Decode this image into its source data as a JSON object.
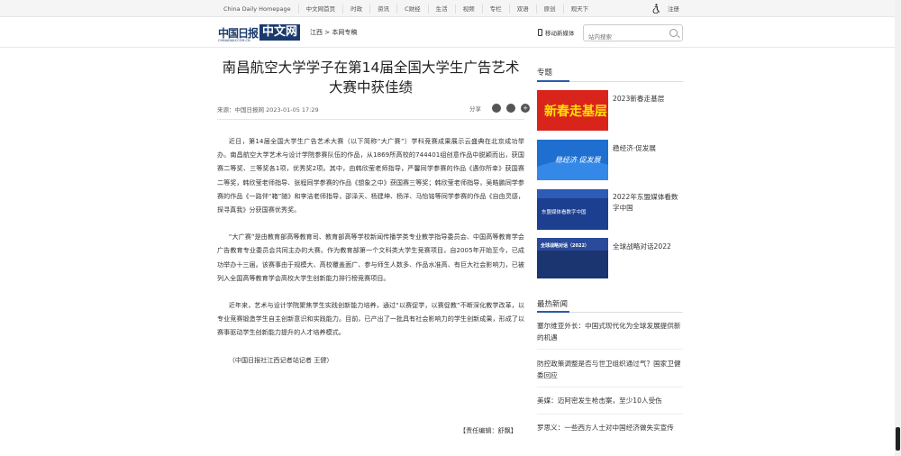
{
  "topnav": [
    "China Daily Homepage",
    "中文网首页",
    "时政",
    "资讯",
    "C财经",
    "生活",
    "视频",
    "专栏",
    "双语",
    "原创",
    "观天下"
  ],
  "login": "注册",
  "logo": {
    "cn": "中国日报",
    "box": "中文网",
    "sub": "CHINADAILY.COM.CN"
  },
  "breadcrumb": "江西 > 本网专稿",
  "mobile": "移动新媒体",
  "search": {
    "placeholder": "站内搜索"
  },
  "article": {
    "title": "南昌航空大学学子在第14届全国大学生广告艺术大赛中获佳绩",
    "meta": "来源：中国日报网 2023-01-05 17:29",
    "share_label": "分享",
    "paragraphs": [
      "近日，第14届全国大学生广告艺术大赛（以下简称“大广赛”）学科竞赛成果展示云盛典在北京成功举办。南昌航空大学艺术与设计学院参赛队伍的作品，从1869所高校的744401组创意作品中脱颖而出，获国赛二等奖、三等奖各1项，优秀奖2项。其中，由韩欣莹老师指导，严馨同学参赛的作品《遇你所幸》获国赛二等奖，韩欣莹老师指导、张程同学参赛的作品《想象之中》获国赛三等奖；韩欣莹老师指导，吴皓鹏同学参赛的作品《一路伴“箱”随》和李洁老师指导，邵泽天、杨建坤、杨洋、马怡铭等同学参赛的作品《自由灵感，探寻真我》分获国赛优秀奖。",
      "“大广赛”是由教育部高等教育司、教育部高等学校新闻传播学类专业教学指导委员会、中国高等教育学会广告教育专业委员会共同主办的大赛。作为教育部第一个文科类大学生竞赛项目，自2005年开始至今，已成功举办十三届。该赛事由于规模大、高校覆盖面广、参与师生人数多、作品水准高、有巨大社会影响力，已被列入全国高等教育学会高校大学生创新能力排行榜竞赛项目。",
      "近年来，艺术与设计学院聚焦学生实践创新能力培养，通过“以赛促学，以赛促教”不断深化教学改革，以专业竞赛锻造学生自主创新意识和实践能力。目前，已产出了一批具有社会影响力的学生创新成果，形成了以赛事驱动学生创新能力提升的人才培养模式。",
      "（中国日报社江西记者站记者 王健）"
    ],
    "editor": "【责任编辑：舒飘】"
  },
  "sidebar": {
    "topics_title": "专题",
    "topics": [
      {
        "label": "2023新春走基层",
        "img_text": "新春走基层",
        "color": "#d9241c"
      },
      {
        "label": "稳经济·促发展",
        "img_text": "稳经济 促发展",
        "color": "#1e6fd0"
      },
      {
        "label": "2022年东盟媒体看数字中国",
        "img_text": "东盟媒体看数字中国",
        "color": "#1d3f8f"
      },
      {
        "label": "全球战略对话2022",
        "img_text": "全球战略对话（2022）",
        "color": "#1a3570"
      }
    ],
    "hot_title": "最热新闻",
    "hot": [
      "塞尔维亚外长：中国式现代化为全球发展提供新的机遇",
      "防控政策调整是否与世卫组织通过气？国家卫健委回应",
      "美媒：迈阿密发生枪击案，至少10人受伤",
      "罗思义：一些西方人士对中国经济做失实宣传"
    ]
  }
}
